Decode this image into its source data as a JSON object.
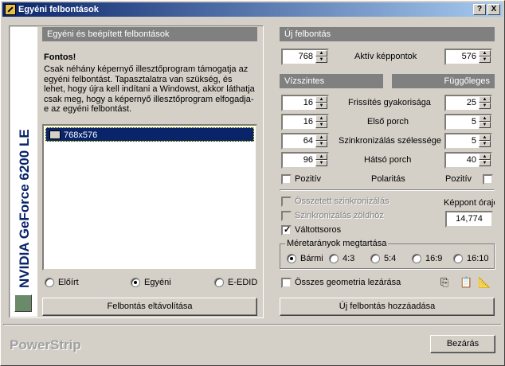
{
  "window": {
    "title": "Egyéni felbontások",
    "help": "?",
    "close": "X"
  },
  "side_banner": {
    "text": "NVIDIA GeForce 6200 LE"
  },
  "left": {
    "section_title": "Egyéni és beépített felbontások",
    "important_title": "Fontos!",
    "important_text": "Csak néhány képernyő illesztőprogram támogatja az egyéni felbontást. Tapasztalatra van szükség, és lehet, hogy újra kell indítani a Windowst, akkor láthatja csak meg, hogy a képernyő illesztőprogram elfogadja-e az egyéni felbontást.",
    "list_items": [
      "768x576"
    ],
    "radios": [
      "Előírt",
      "Egyéni",
      "E-EDID"
    ],
    "selected_radio": "Egyéni",
    "remove_button": "Felbontás eltávolítása"
  },
  "right": {
    "new_res_title": "Új felbontás",
    "active_pixels_label": "Aktív képpontok",
    "active_h": "768",
    "active_v": "576",
    "horizontal_title": "Vízszintes",
    "vertical_title": "Függőleges",
    "rows": [
      {
        "label": "Frissítés gyakorisága",
        "h": "16",
        "v": "25"
      },
      {
        "label": "Első porch",
        "h": "16",
        "v": "5"
      },
      {
        "label": "Szinkronizálás szélessége",
        "h": "64",
        "v": "5"
      },
      {
        "label": "Hátsó porch",
        "h": "96",
        "v": "40"
      }
    ],
    "polarity_label": "Polaritás",
    "positive_h": "Pozitív",
    "positive_v": "Pozitív",
    "composite_sync": "Összetett szinkronizálás",
    "sync_on_green": "Szinkronizálás zöldhöz",
    "interlaced": "Váltottsoros",
    "pixel_clock_label": "Képpont órajel",
    "pixel_clock_value": "14,774",
    "aspect_title": "Méretarányok megtartása",
    "aspect_options": [
      "Bármi",
      "4:3",
      "5:4",
      "16:9",
      "16:10"
    ],
    "aspect_selected": "Bármi",
    "lock_geometry": "Összes geometria lezárása",
    "add_button": "Új felbontás hozzáadása"
  },
  "footer": {
    "brand": "PowerStrip",
    "close_button": "Bezárás"
  },
  "colors": {
    "title_start": "#0a246a",
    "title_end": "#a6caf0",
    "header_bg": "#808080",
    "selected_bg": "#0a246a"
  }
}
